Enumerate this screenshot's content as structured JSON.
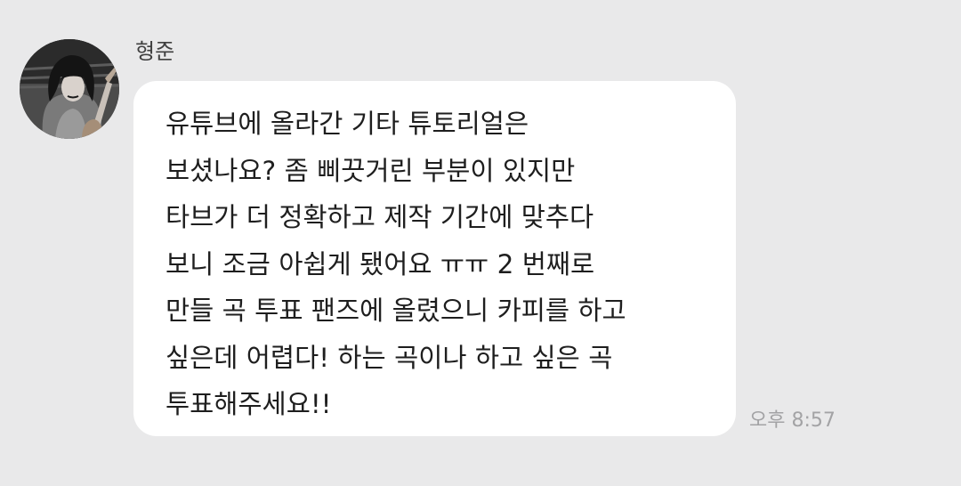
{
  "message": {
    "sender": {
      "name": "형준",
      "avatar_icon": "profile-photo-guitarist"
    },
    "lines": [
      "유튜브에 올라간 기타 튜토리얼은",
      "보셨나요? 좀 삐끗거린 부분이 있지만",
      "타브가 더 정확하고 제작 기간에 맞추다",
      "보니 조금 아쉽게 됐어요 ㅠㅠ 2 번째로",
      "만들 곡 투표 팬즈에 올렸으니 카피를 하고",
      "싶은데 어렵다! 하는 곡이나 하고 싶은 곡",
      "투표해주세요!!"
    ],
    "time": "오후 8:57"
  },
  "colors": {
    "background": "#e9e9ea",
    "bubble": "#ffffff",
    "text": "#1e1e1e",
    "timestamp": "#a3a3a5"
  }
}
